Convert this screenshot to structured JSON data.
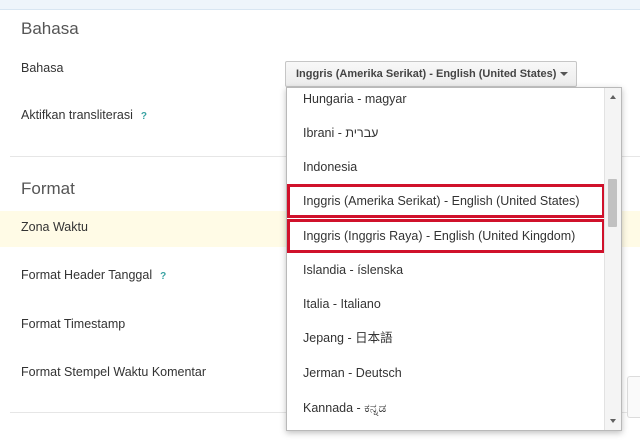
{
  "language_section": {
    "title": "Bahasa",
    "language_label": "Bahasa",
    "transliteration_label": "Aktifkan transliterasi",
    "help_mark": "?"
  },
  "format_section": {
    "title": "Format",
    "timezone_label": "Zona Waktu",
    "date_header_label": "Format Header Tanggal",
    "timestamp_label": "Format Timestamp",
    "comment_timestamp_label": "Format Stempel Waktu Komentar"
  },
  "language_select": {
    "selected_value": "Inggris (Amerika Serikat) - English (United States)",
    "options": [
      "Hungaria - magyar",
      "Ibrani - עברית",
      "Indonesia",
      "Inggris (Amerika Serikat) - English (United States)",
      "Inggris (Inggris Raya) - English (United Kingdom)",
      "Islandia - íslenska",
      "Italia - Italiano",
      "Jepang - 日本語",
      "Jerman - Deutsch",
      "Kannada - ಕನ್ನಡ"
    ]
  },
  "annotation_color": "#d0112b"
}
